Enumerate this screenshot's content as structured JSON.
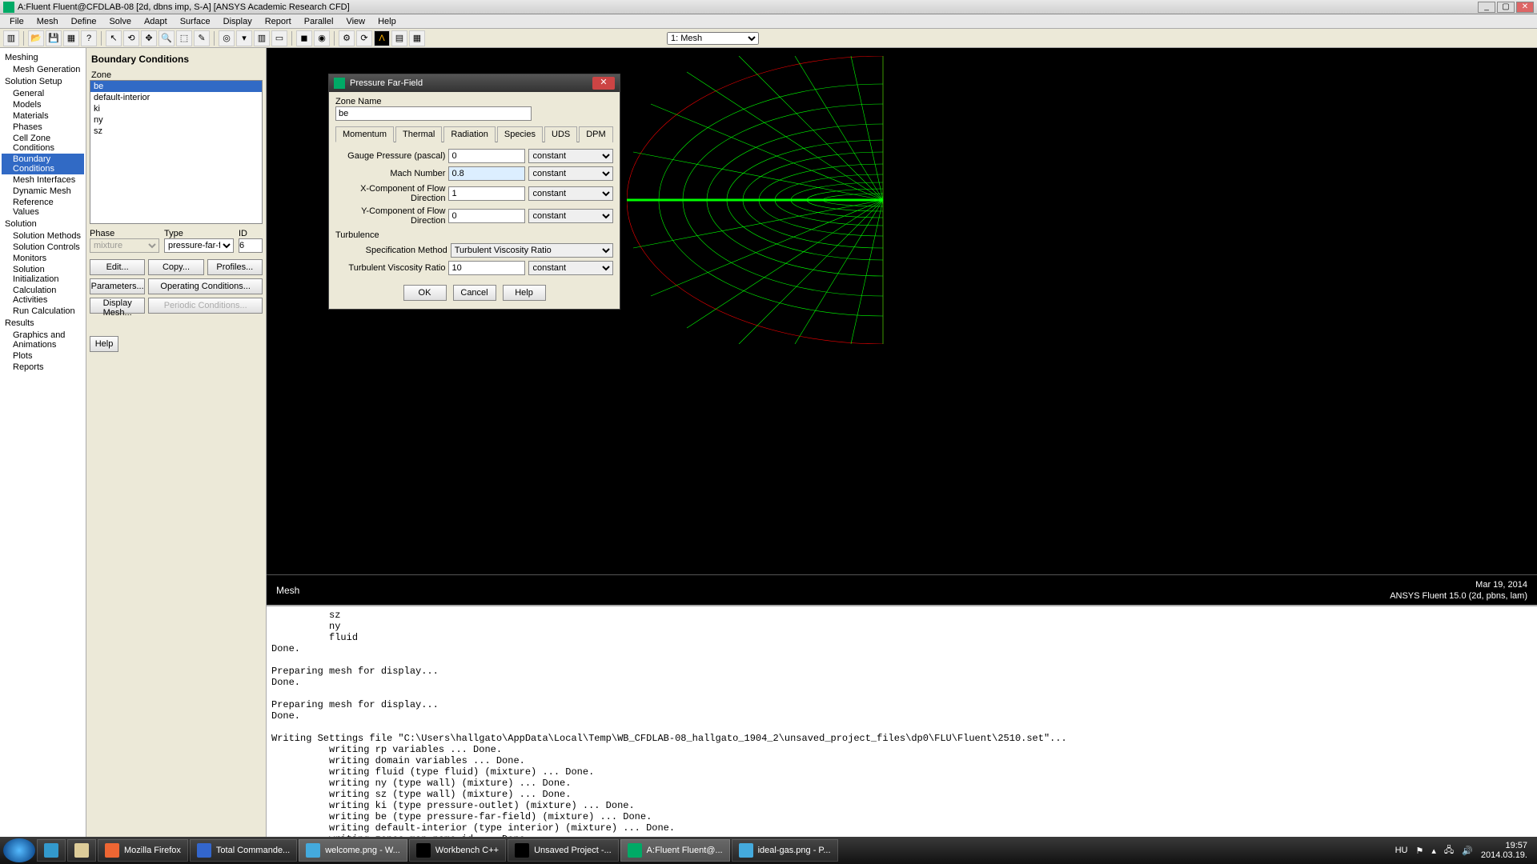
{
  "window": {
    "title": "A:Fluent Fluent@CFDLAB-08  [2d, dbns imp, S-A] [ANSYS Academic Research CFD]"
  },
  "menu": [
    "File",
    "Mesh",
    "Define",
    "Solve",
    "Adapt",
    "Surface",
    "Display",
    "Report",
    "Parallel",
    "View",
    "Help"
  ],
  "mesh_selector": "1: Mesh",
  "tree": {
    "meshing": "Meshing",
    "mesh_generation": "Mesh Generation",
    "solution_setup": "Solution Setup",
    "general": "General",
    "models": "Models",
    "materials": "Materials",
    "phases": "Phases",
    "cell_zone": "Cell Zone Conditions",
    "boundary": "Boundary Conditions",
    "mesh_interfaces": "Mesh Interfaces",
    "dynamic_mesh": "Dynamic Mesh",
    "reference_values": "Reference Values",
    "solution": "Solution",
    "solution_methods": "Solution Methods",
    "solution_controls": "Solution Controls",
    "monitors": "Monitors",
    "solution_init": "Solution Initialization",
    "calc_activities": "Calculation Activities",
    "run_calc": "Run Calculation",
    "results": "Results",
    "graphics": "Graphics and Animations",
    "plots": "Plots",
    "reports": "Reports"
  },
  "task": {
    "title": "Boundary Conditions",
    "zone_label": "Zone",
    "zones": [
      "be",
      "default-interior",
      "ki",
      "ny",
      "sz"
    ],
    "phase_label": "Phase",
    "phase_value": "mixture",
    "type_label": "Type",
    "type_value": "pressure-far-field",
    "id_label": "ID",
    "id_value": "6",
    "edit": "Edit...",
    "copy": "Copy...",
    "profiles": "Profiles...",
    "parameters": "Parameters...",
    "opcond": "Operating Conditions...",
    "display_mesh": "Display Mesh...",
    "periodic": "Periodic Conditions...",
    "help": "Help"
  },
  "dialog": {
    "title": "Pressure Far-Field",
    "zone_name_label": "Zone Name",
    "zone_name": "be",
    "tabs": [
      "Momentum",
      "Thermal",
      "Radiation",
      "Species",
      "UDS",
      "DPM"
    ],
    "gauge_label": "Gauge Pressure (pascal)",
    "gauge_value": "0",
    "mach_label": "Mach Number",
    "mach_value": "0.8",
    "xcomp_label": "X-Component of Flow Direction",
    "xcomp_value": "1",
    "ycomp_label": "Y-Component of Flow Direction",
    "ycomp_value": "0",
    "constant": "constant",
    "turb_header": "Turbulence",
    "spec_label": "Specification Method",
    "spec_value": "Turbulent Viscosity Ratio",
    "tvr_label": "Turbulent Viscosity Ratio",
    "tvr_value": "10",
    "ok": "OK",
    "cancel": "Cancel",
    "help": "Help"
  },
  "gfx": {
    "label": "Mesh",
    "date": "Mar 19, 2014",
    "version": "ANSYS Fluent 15.0 (2d, pbns, lam)"
  },
  "console_text": "          sz\n          ny\n          fluid\nDone.\n\nPreparing mesh for display...\nDone.\n\nPreparing mesh for display...\nDone.\n\nWriting Settings file \"C:\\Users\\hallgato\\AppData\\Local\\Temp\\WB_CFDLAB-08_hallgato_1904_2\\unsaved_project_files\\dp0\\FLU\\Fluent\\2510.set\"...\n          writing rp variables ... Done.\n          writing domain variables ... Done.\n          writing fluid (type fluid) (mixture) ... Done.\n          writing ny (type wall) (mixture) ... Done.\n          writing sz (type wall) (mixture) ... Done.\n          writing ki (type pressure-outlet) (mixture) ... Done.\n          writing be (type pressure-far-field) (mixture) ... Done.\n          writing default-interior (type interior) (mixture) ... Done.\n          writing zones map name-id ... Done.\n\nNote: Enabling energy equation as required by material density method.\n",
  "taskbar": {
    "apps": [
      {
        "label": "Mozilla Firefox"
      },
      {
        "label": "Total Commande..."
      },
      {
        "label": "welcome.png - W..."
      },
      {
        "label": "Workbench C++"
      },
      {
        "label": "Unsaved Project -..."
      },
      {
        "label": "A:Fluent Fluent@..."
      },
      {
        "label": "ideal-gas.png - P..."
      }
    ],
    "lang": "HU",
    "time": "19:57",
    "date": "2014.03.19."
  }
}
